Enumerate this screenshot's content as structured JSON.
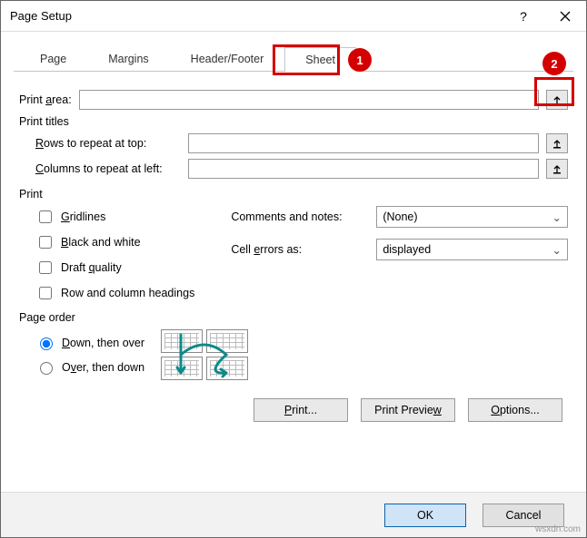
{
  "window": {
    "title": "Page Setup"
  },
  "tabs": {
    "items": [
      "Page",
      "Margins",
      "Header/Footer",
      "Sheet"
    ],
    "active": 3
  },
  "printArea": {
    "label": "Print area:",
    "value": ""
  },
  "printTitles": {
    "group": "Print titles",
    "rowsLabel": "Rows to repeat at top:",
    "rowsValue": "",
    "colsLabel": "Columns to repeat at left:",
    "colsValue": ""
  },
  "printSection": {
    "group": "Print",
    "gridlines": "Gridlines",
    "bw": "Black and white",
    "draft": "Draft quality",
    "rowcol": "Row and column headings",
    "commentsLabel": "Comments and notes:",
    "commentsValue": "(None)",
    "errorsLabel": "Cell errors as:",
    "errorsValue": "displayed"
  },
  "pageOrder": {
    "group": "Page order",
    "down": "Down, then over",
    "over": "Over, then down"
  },
  "buttons": {
    "print": "Print...",
    "preview": "Print Preview",
    "options": "Options...",
    "ok": "OK",
    "cancel": "Cancel"
  },
  "callouts": {
    "one": "1",
    "two": "2"
  },
  "watermark": "wsxdn.com"
}
